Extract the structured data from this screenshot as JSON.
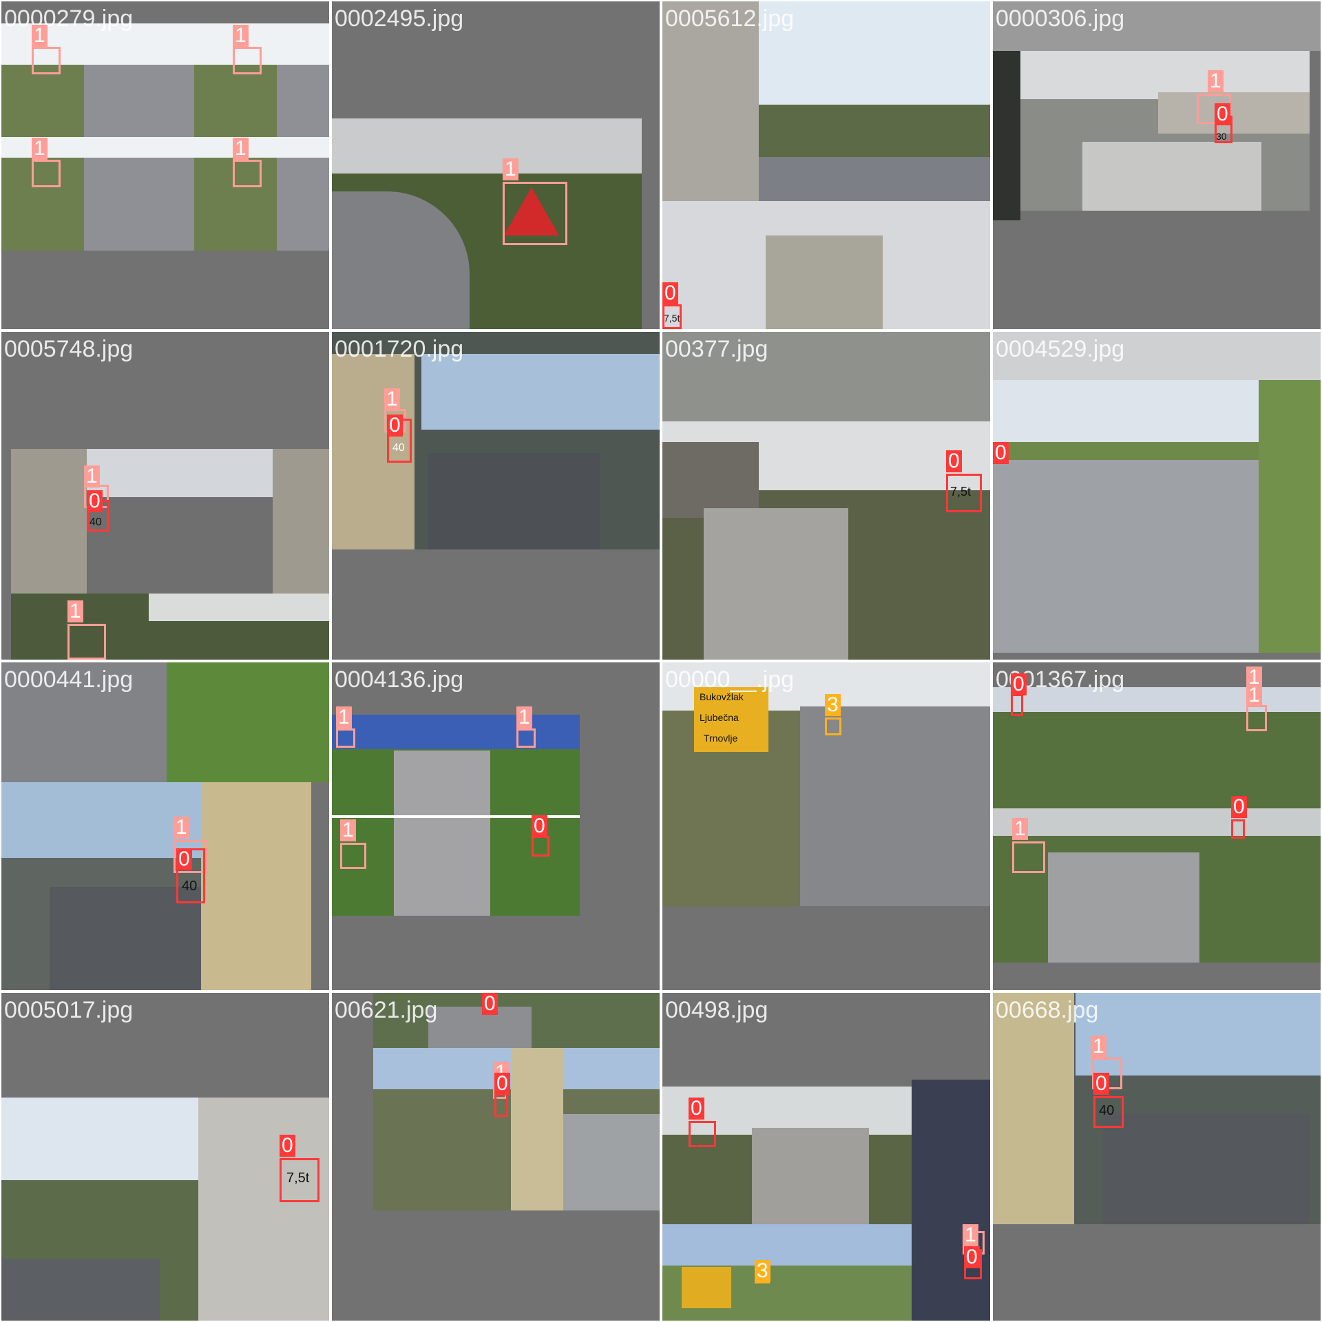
{
  "tiles": [
    {
      "filename": "0000279.jpg",
      "labels": [
        "1",
        "1",
        "1",
        "1"
      ]
    },
    {
      "filename": "0002495.jpg",
      "labels": [
        "1"
      ]
    },
    {
      "filename": "0005612.jpg",
      "labels": [
        "0"
      ]
    },
    {
      "filename": "0000306.jpg",
      "labels": [
        "1",
        "0"
      ]
    },
    {
      "filename": "0005748.jpg",
      "labels": [
        "1",
        "0",
        "1"
      ]
    },
    {
      "filename": "0001720.jpg",
      "labels": [
        "1",
        "0"
      ]
    },
    {
      "filename": "00377.jpg",
      "labels": [
        "0"
      ]
    },
    {
      "filename": "0004529.jpg",
      "labels": [
        "0"
      ]
    },
    {
      "filename": "0000441.jpg",
      "labels": [
        "1",
        "0"
      ]
    },
    {
      "filename": "0004136.jpg",
      "labels": [
        "1",
        "1",
        "1",
        "0"
      ]
    },
    {
      "filename": "00000__.jpg",
      "labels": [
        "3"
      ]
    },
    {
      "filename": "0001367.jpg",
      "labels": [
        "0",
        "1",
        "1",
        "1",
        "0"
      ]
    },
    {
      "filename": "0005017.jpg",
      "labels": [
        "0"
      ]
    },
    {
      "filename": "00621.jpg",
      "labels": [
        "0",
        "1",
        "0"
      ]
    },
    {
      "filename": "00498.jpg",
      "labels": [
        "0",
        "3",
        "1",
        "0"
      ]
    },
    {
      "filename": "00668.jpg",
      "labels": [
        "1",
        "0"
      ]
    }
  ],
  "sign_texts": {
    "speed_40": "40",
    "weight_75": "7,5t",
    "speed_30": "30",
    "dir_1": "Bukovžlak",
    "dir_2": "Ljubečna",
    "dir_3": "Trnovlje"
  },
  "colors": {
    "class_0": "#ff3838",
    "class_1": "#ff9d97",
    "class_3": "#ffb21d",
    "padding_gray": "#727272"
  }
}
